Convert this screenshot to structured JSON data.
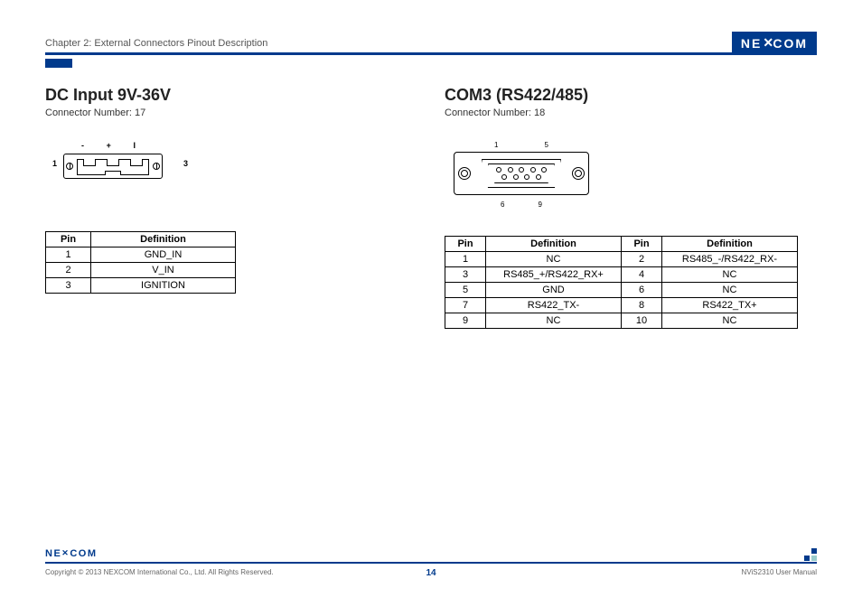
{
  "header": {
    "chapter": "Chapter 2: External Connectors Pinout Description",
    "logo_text": "NE COM",
    "logo_x": "X"
  },
  "left": {
    "title": "DC Input 9V-36V",
    "connector": "Connector Number: 17",
    "diag_top": {
      "minus": "-",
      "plus": "+",
      "i": "I"
    },
    "diag_side": {
      "l": "1",
      "r": "3"
    },
    "table": {
      "headers": [
        "Pin",
        "Definition"
      ],
      "rows": [
        [
          "1",
          "GND_IN"
        ],
        [
          "2",
          "V_IN"
        ],
        [
          "3",
          "IGNITION"
        ]
      ]
    }
  },
  "right": {
    "title": "COM3 (RS422/485)",
    "connector": "Connector Number: 18",
    "diag_top": {
      "a": "1",
      "b": "5"
    },
    "diag_bot": {
      "a": "6",
      "b": "9"
    },
    "table": {
      "headers": [
        "Pin",
        "Definition",
        "Pin",
        "Definition"
      ],
      "rows": [
        [
          "1",
          "NC",
          "2",
          "RS485_-/RS422_RX-"
        ],
        [
          "3",
          "RS485_+/RS422_RX+",
          "4",
          "NC"
        ],
        [
          "5",
          "GND",
          "6",
          "NC"
        ],
        [
          "7",
          "RS422_TX-",
          "8",
          "RS422_TX+"
        ],
        [
          "9",
          "NC",
          "10",
          "NC"
        ]
      ]
    }
  },
  "footer": {
    "logo": "NEXCOM",
    "copyright": "Copyright © 2013 NEXCOM International Co., Ltd. All Rights Reserved.",
    "page": "14",
    "manual": "NViS2310 User Manual"
  }
}
